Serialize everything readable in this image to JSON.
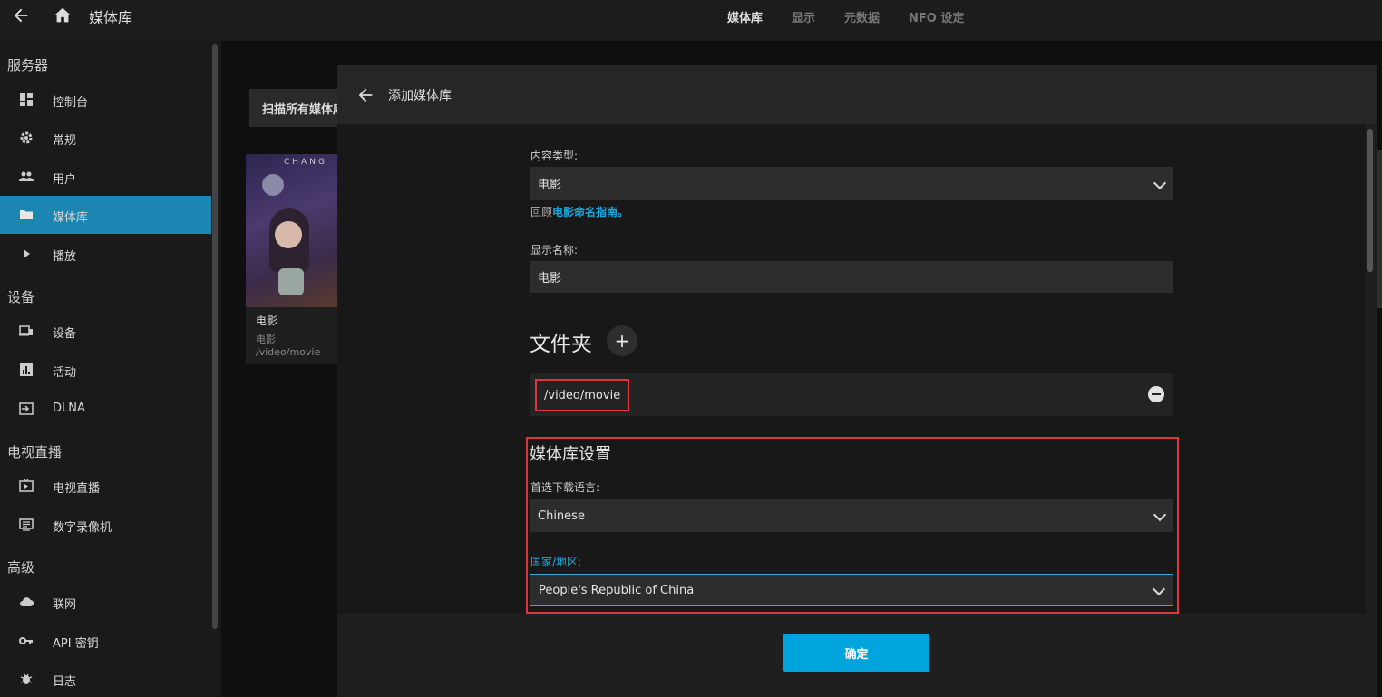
{
  "topbar": {
    "title": "媒体库",
    "tabs": [
      {
        "label": "媒体库",
        "active": true
      },
      {
        "label": "显示",
        "active": false
      },
      {
        "label": "元数据",
        "active": false
      },
      {
        "label": "NFO 设定",
        "active": false
      }
    ]
  },
  "sidebar": {
    "sections": {
      "server": "服务器",
      "devices": "设备",
      "livetv": "电视直播",
      "advanced": "高级"
    },
    "items": {
      "dashboard": "控制台",
      "general": "常规",
      "users": "用户",
      "libraries": "媒体库",
      "playback": "播放",
      "devices": "设备",
      "activity": "活动",
      "dlna": "DLNA",
      "livetv": "电视直播",
      "dvr": "数字录像机",
      "networking": "联网",
      "apikeys": "API 密钥",
      "logs": "日志"
    },
    "active_item": "libraries"
  },
  "background": {
    "scan_button": "扫描所有媒体库",
    "library_card": {
      "poster_text": "CHANG",
      "name": "电影",
      "type": "电影",
      "path": "/video/movie"
    }
  },
  "dialog": {
    "title": "添加媒体库",
    "content_type_label": "内容类型:",
    "content_type_value": "电影",
    "naming_prefix": "回顾",
    "naming_link": "电影命名指南。",
    "display_name_label": "显示名称:",
    "display_name_value": "电影",
    "folders_title": "文件夹",
    "folder_path": "/video/movie",
    "settings_title": "媒体库设置",
    "preferred_language_label": "首选下载语言:",
    "preferred_language_value": "Chinese",
    "country_label": "国家/地区:",
    "country_value": "People's Republic of China",
    "ok_button": "确定"
  },
  "colors": {
    "accent": "#00a4dc",
    "active_nav": "#1b86b1",
    "highlight_border": "#e0353a"
  }
}
